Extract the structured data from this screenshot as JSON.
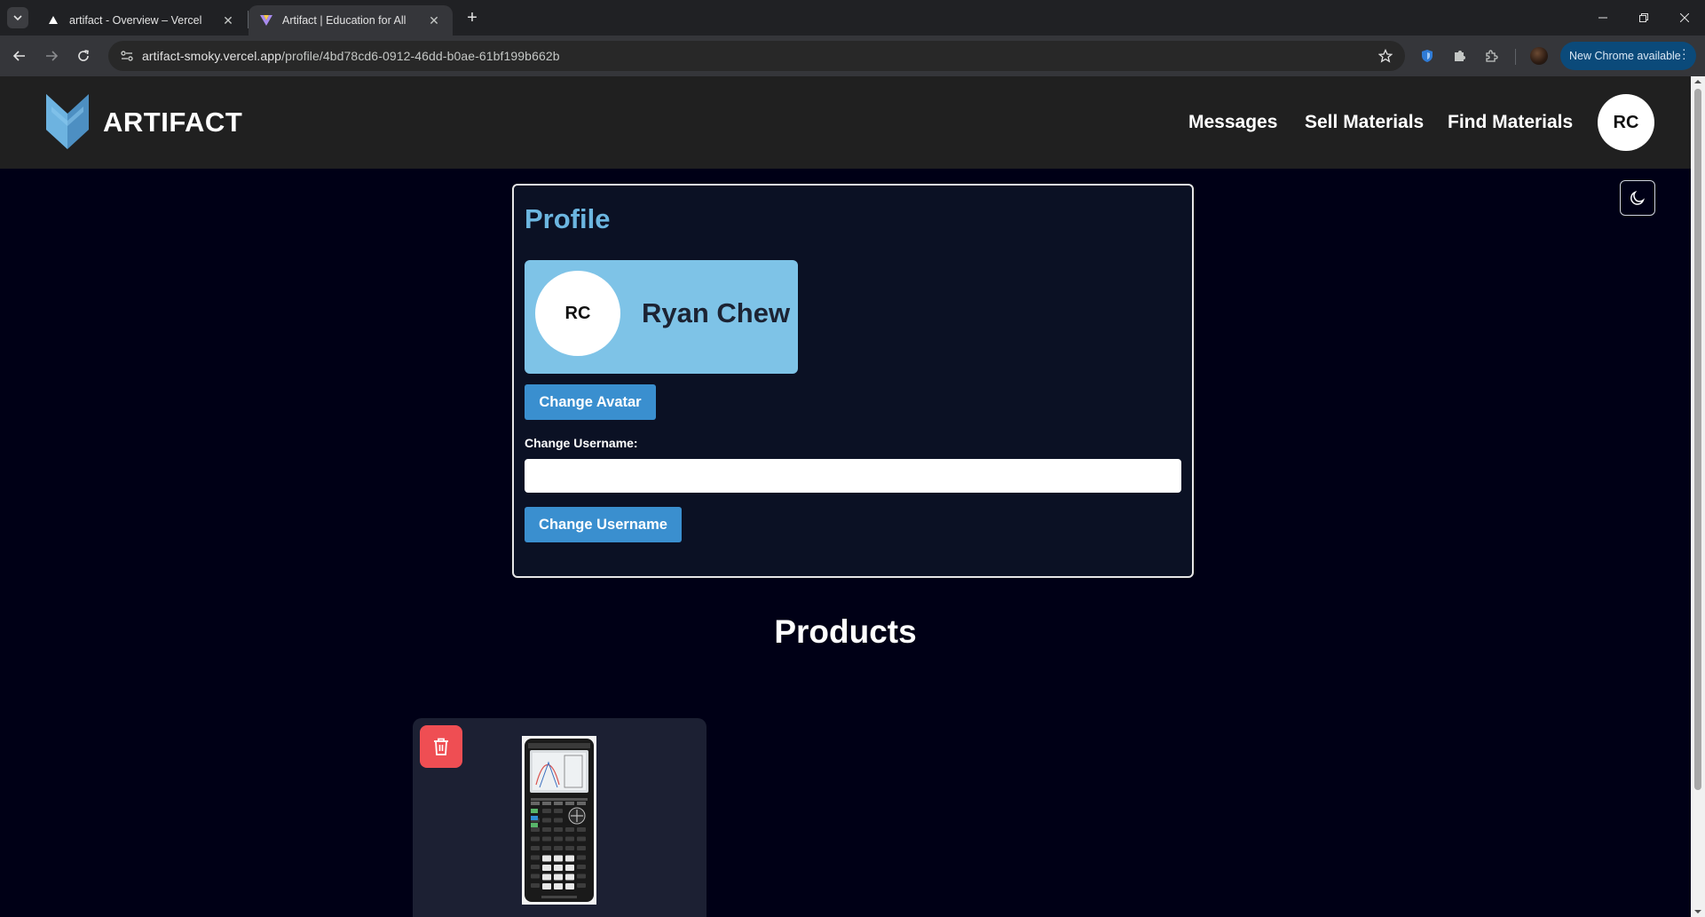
{
  "browser": {
    "tabs": [
      {
        "title": "artifact - Overview – Vercel",
        "active": false
      },
      {
        "title": "Artifact | Education for All",
        "active": true
      }
    ],
    "url_host": "artifact-smoky.vercel.app",
    "url_path": "/profile/4bd78cd6-0912-46dd-b0ae-61bf199b662b",
    "update_label": "New Chrome available"
  },
  "header": {
    "brand": "ARTIFACT",
    "nav": {
      "messages": "Messages",
      "sell": "Sell Materials",
      "find": "Find Materials"
    },
    "user_initials": "RC"
  },
  "profile": {
    "title": "Profile",
    "initials": "RC",
    "name": "Ryan Chew",
    "change_avatar_label": "Change Avatar",
    "username_label": "Change Username:",
    "username_value": "",
    "username_placeholder": "",
    "change_username_label": "Change Username"
  },
  "products": {
    "heading": "Products"
  },
  "colors": {
    "page_bg": "#000016",
    "header_bg": "#202020",
    "accent_title": "#6cb6e0",
    "banner": "#7ec3e7",
    "button": "#3a8fcf",
    "delete": "#ef4e53",
    "card_bg": "#1c2033"
  }
}
